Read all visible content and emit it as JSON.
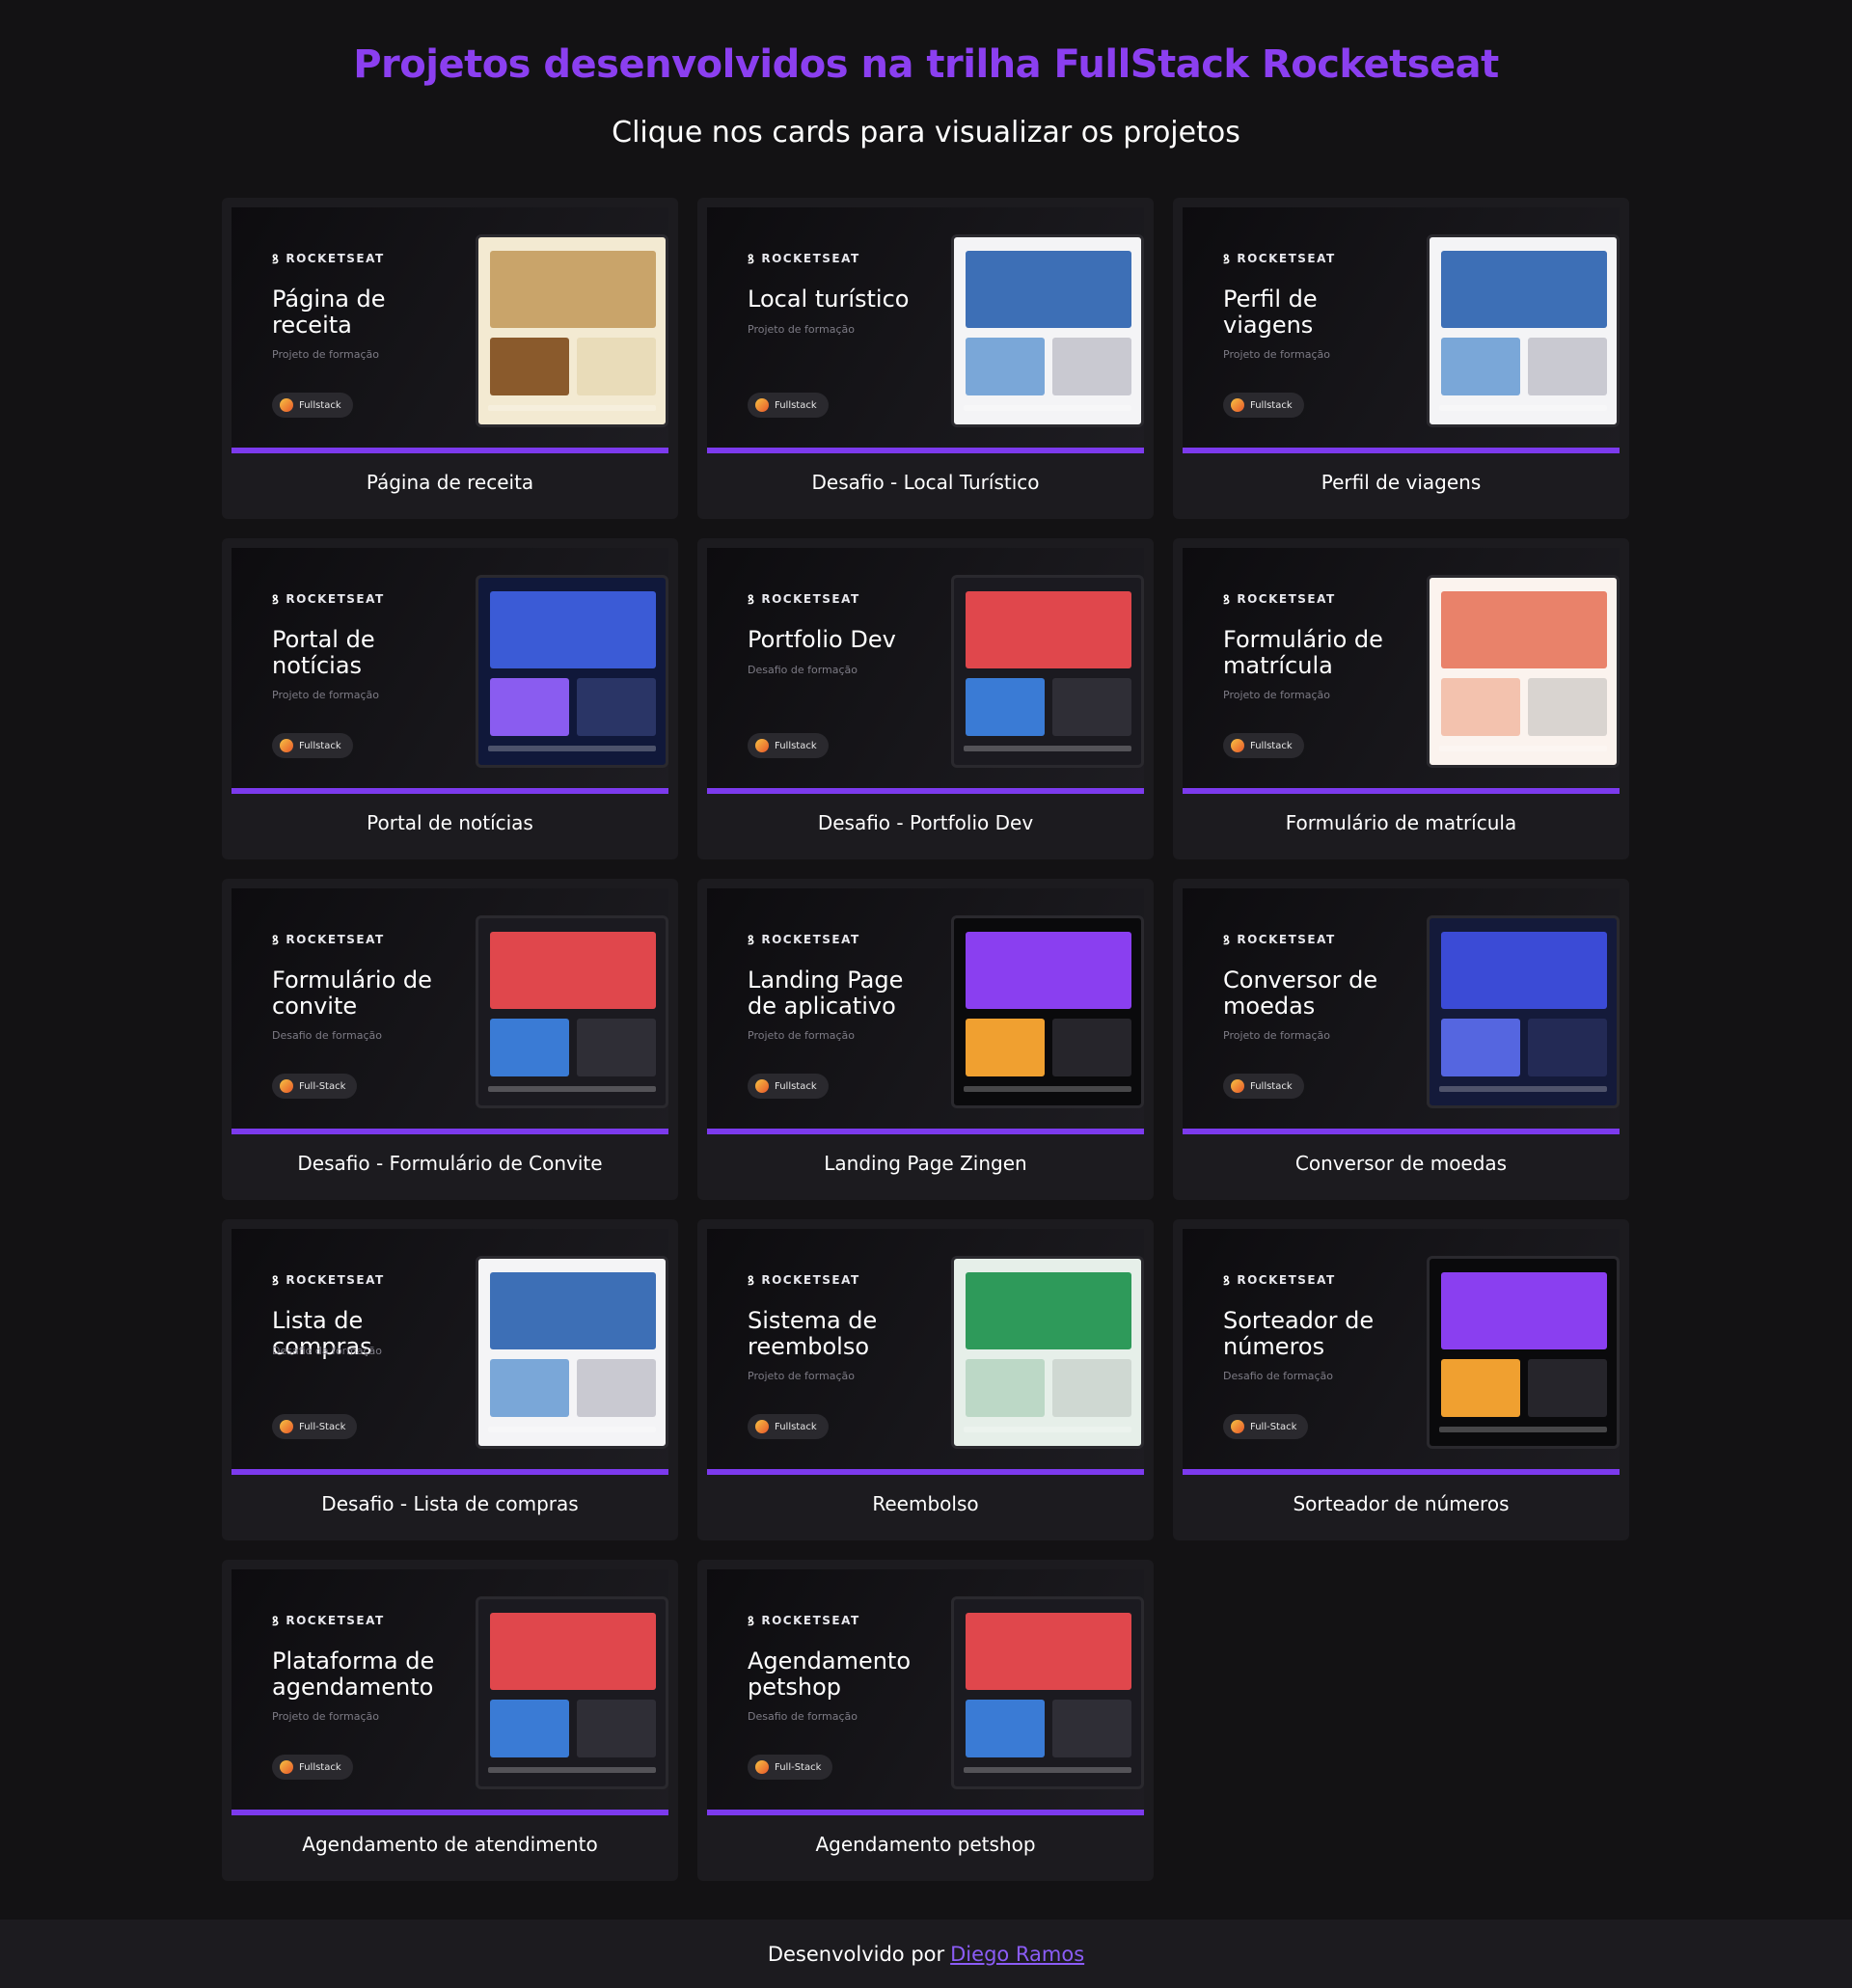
{
  "header": {
    "title": "Projetos desenvolvidos na trilha FullStack Rocketseat",
    "subtitle": "Clique nos cards para visualizar os projetos"
  },
  "brand": {
    "logo_text": "ROCKETSEAT",
    "logo_mark": "ꝸ"
  },
  "colors": {
    "accent": "#7c3aed",
    "title": "#8b3ff0",
    "background": "#131214",
    "card": "#1c1b1f"
  },
  "cards": [
    {
      "thumb_title": "Página de receita",
      "thumb_subtitle": "Projeto de formação",
      "badge": "Fullstack",
      "label": "Página de receita",
      "mock_theme": "cream"
    },
    {
      "thumb_title": "Local turístico",
      "thumb_subtitle": "Projeto de formação",
      "badge": "Fullstack",
      "label": "Desafio - Local Turístico",
      "mock_theme": "light"
    },
    {
      "thumb_title": "Perfil de viagens",
      "thumb_subtitle": "Projeto de formação",
      "badge": "Fullstack",
      "label": "Perfil de viagens",
      "mock_theme": "light"
    },
    {
      "thumb_title": "Portal de notícias",
      "thumb_subtitle": "Projeto de formação",
      "badge": "Fullstack",
      "label": "Portal de notícias",
      "mock_theme": "navy"
    },
    {
      "thumb_title": "Portfolio Dev",
      "thumb_subtitle": "Desafio de formação",
      "badge": "Fullstack",
      "label": "Desafio - Portfolio Dev",
      "mock_theme": "dark"
    },
    {
      "thumb_title": "Formulário de matrícula",
      "thumb_subtitle": "Projeto de formação",
      "badge": "Fullstack",
      "label": "Formulário de matrícula",
      "mock_theme": "peach"
    },
    {
      "thumb_title": "Formulário de convite",
      "thumb_subtitle": "Desafio de formação",
      "badge": "Full-Stack",
      "label": "Desafio - Formulário de Convite",
      "mock_theme": "dark"
    },
    {
      "thumb_title": "Landing Page de aplicativo",
      "thumb_subtitle": "Projeto de formação",
      "badge": "Fullstack",
      "label": "Landing Page Zingen",
      "mock_theme": "black"
    },
    {
      "thumb_title": "Conversor de moedas",
      "thumb_subtitle": "Projeto de formação",
      "badge": "Fullstack",
      "label": "Conversor de moedas",
      "mock_theme": "indigo"
    },
    {
      "thumb_title": "Lista de compras",
      "thumb_subtitle": "Desafio da formação",
      "badge": "Full-Stack",
      "label": "Desafio - Lista de compras",
      "mock_theme": "light"
    },
    {
      "thumb_title": "Sistema de reembolso",
      "thumb_subtitle": "Projeto de formação",
      "badge": "Fullstack",
      "label": "Reembolso",
      "mock_theme": "mint"
    },
    {
      "thumb_title": "Sorteador de números",
      "thumb_subtitle": "Desafio de formação",
      "badge": "Full-Stack",
      "label": "Sorteador de números",
      "mock_theme": "black"
    },
    {
      "thumb_title": "Plataforma de agendamento",
      "thumb_subtitle": "Projeto de formação",
      "badge": "Fullstack",
      "label": "Agendamento de atendimento",
      "mock_theme": "dark"
    },
    {
      "thumb_title": "Agendamento petshop",
      "thumb_subtitle": "Desafio de formação",
      "badge": "Full-Stack",
      "label": "Agendamento petshop",
      "mock_theme": "dark"
    }
  ],
  "footer": {
    "text": "Desenvolvido por",
    "author": "Diego Ramos"
  }
}
